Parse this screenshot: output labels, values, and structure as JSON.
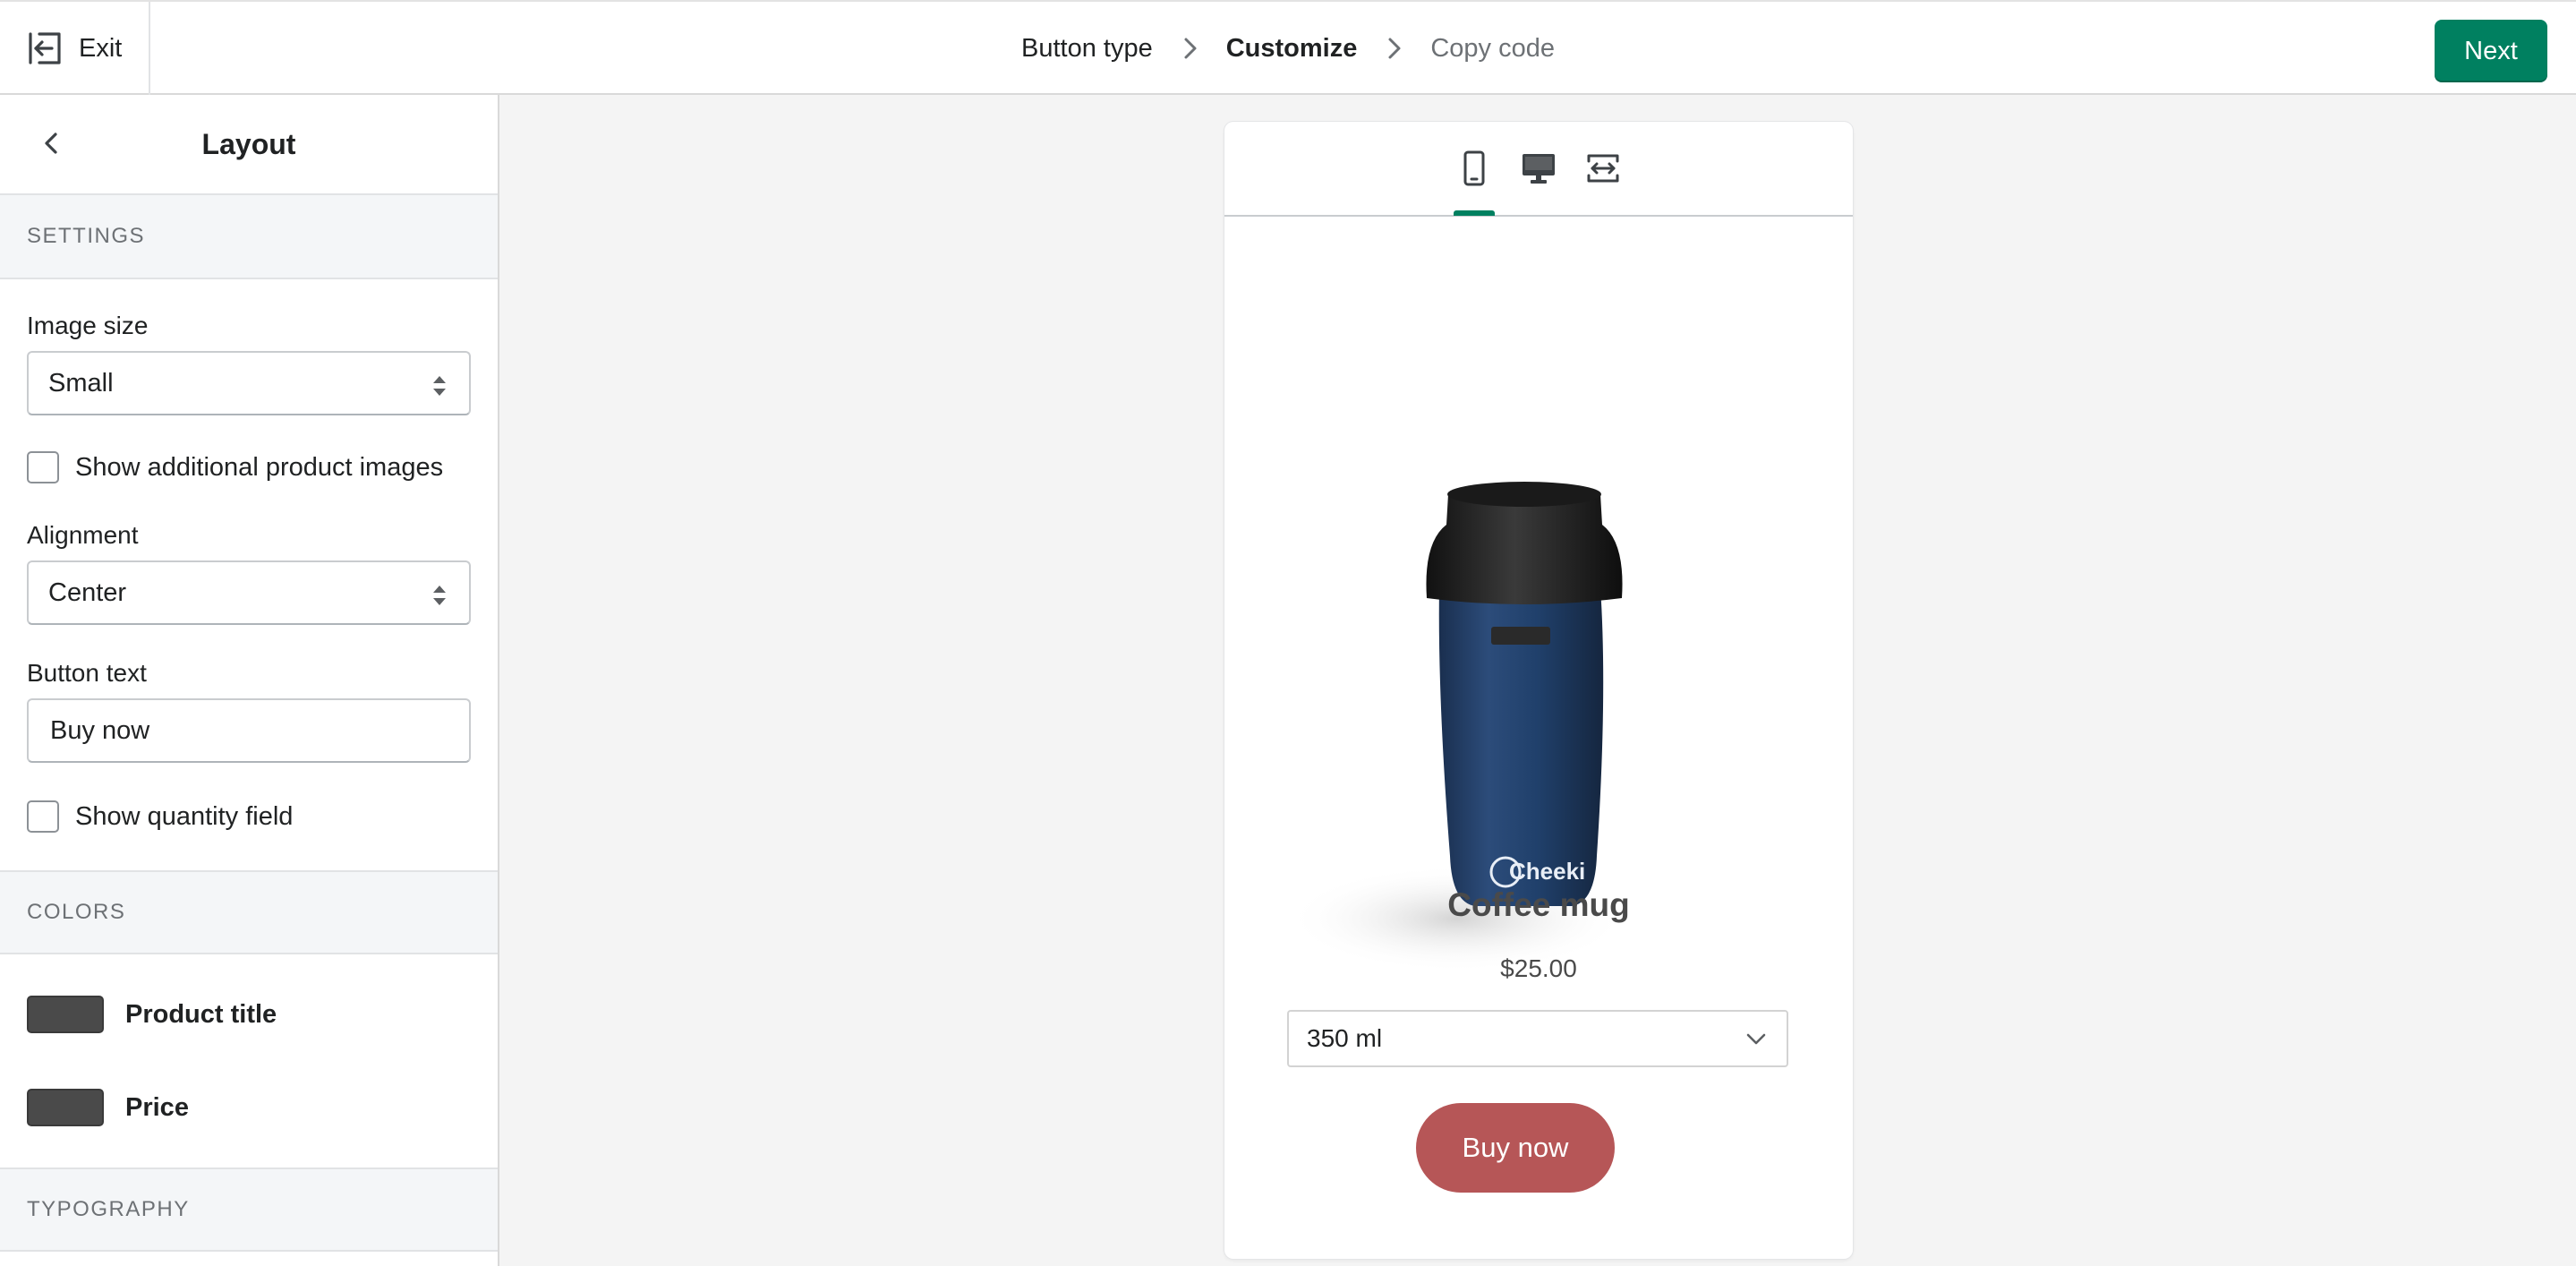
{
  "topbar": {
    "exit_label": "Exit",
    "steps": [
      {
        "label": "Button type",
        "state": "done"
      },
      {
        "label": "Customize",
        "state": "active"
      },
      {
        "label": "Copy code",
        "state": "future"
      }
    ],
    "next_label": "Next"
  },
  "sidebar": {
    "title": "Layout",
    "settings": {
      "heading": "SETTINGS",
      "image_size_label": "Image size",
      "image_size_value": "Small",
      "show_additional_images_label": "Show additional product images",
      "alignment_label": "Alignment",
      "alignment_value": "Center",
      "button_text_label": "Button text",
      "button_text_value": "Buy now",
      "show_quantity_label": "Show quantity field"
    },
    "colors": {
      "heading": "COLORS",
      "product_title_label": "Product title",
      "price_label": "Price",
      "swatch_color": "#4a4a4a"
    },
    "typography": {
      "heading": "TYPOGRAPHY"
    }
  },
  "preview": {
    "device_tabs": [
      "mobile-icon",
      "desktop-icon",
      "full-width-icon"
    ],
    "active_tab": "mobile",
    "product_title": "Coffee mug",
    "price": "$25.00",
    "variant": "350 ml",
    "buy_button": "Buy now",
    "brand_text": "Cheeki",
    "buy_button_color": "#b65657",
    "accent_color": "#008060"
  }
}
